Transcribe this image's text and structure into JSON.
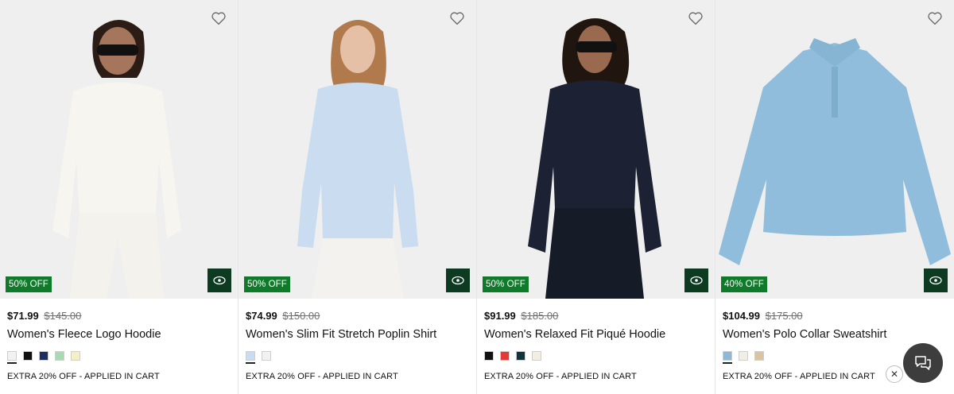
{
  "products": [
    {
      "name": "Women's Fleece Logo Hoodie",
      "price": "$71.99",
      "original_price": "$145.00",
      "badge": "50% OFF",
      "promo": "EXTRA 20% OFF - APPLIED IN CART",
      "garment_color": "#f6f5f0",
      "swatches": [
        "#f2f2f2",
        "#111111",
        "#1c2f5e",
        "#a9d9b1",
        "#f4f0c6"
      ]
    },
    {
      "name": "Women's Slim Fit Stretch Poplin Shirt",
      "price": "$74.99",
      "original_price": "$150.00",
      "badge": "50% OFF",
      "promo": "EXTRA 20% OFF - APPLIED IN CART",
      "garment_color": "#c9dcf0",
      "swatches": [
        "#c8dcf2",
        "#f2f2f2"
      ]
    },
    {
      "name": "Women's Relaxed Fit Piqué Hoodie",
      "price": "$91.99",
      "original_price": "$185.00",
      "badge": "50% OFF",
      "promo": "EXTRA 20% OFF - APPLIED IN CART",
      "garment_color": "#1c2233",
      "swatches": [
        "#111111",
        "#e53935",
        "#12343a",
        "#f2efe2"
      ]
    },
    {
      "name": "Women's Polo Collar Sweatshirt",
      "price": "$104.99",
      "original_price": "$175.00",
      "badge": "40% OFF",
      "promo": "EXTRA 20% OFF - APPLIED IN CART",
      "garment_color": "#8fbddb",
      "swatches": [
        "#8db8d8",
        "#f1eee6",
        "#d9c3a0"
      ]
    }
  ],
  "icons": {
    "wishlist": "heart-outline-icon",
    "quick_view": "eye-icon",
    "chat": "chat-bubbles-icon",
    "close": "close-icon"
  },
  "colors": {
    "badge_bg": "#0f7a2a",
    "quick_view_bg": "#0d3b22",
    "chat_bg": "#3d3d3d"
  }
}
